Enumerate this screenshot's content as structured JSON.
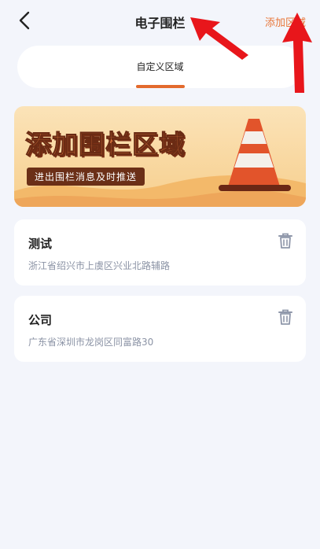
{
  "header": {
    "title": "电子围栏",
    "add_area_label": "添加区域"
  },
  "tabs": [
    {
      "label": "自定义区域",
      "active": true
    }
  ],
  "banner": {
    "title": "添加围栏区域",
    "subtitle": "进出围栏消息及时推送"
  },
  "areas": [
    {
      "name": "测试",
      "address": "浙江省绍兴市上虞区兴业北路辅路"
    },
    {
      "name": "公司",
      "address": "广东省深圳市龙岗区同富路30"
    }
  ],
  "colors": {
    "accent": "#e8773a",
    "background": "#f3f5fb",
    "card": "#ffffff",
    "annotation_arrow": "#e8161b"
  },
  "icons": {
    "back": "chevron-left-icon",
    "delete": "trash-icon",
    "banner_image": "traffic-cone-icon"
  }
}
